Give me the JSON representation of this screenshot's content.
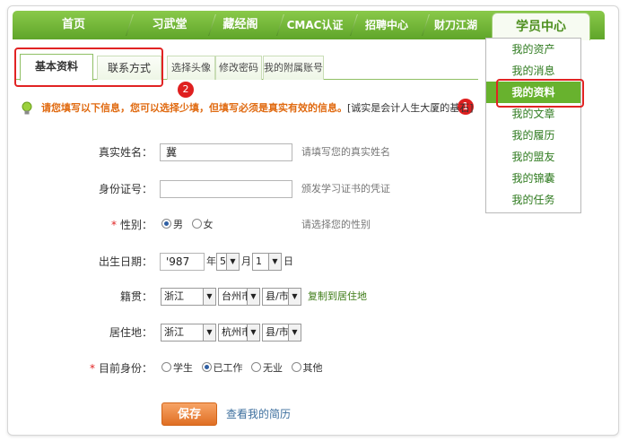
{
  "nav": {
    "items": [
      "首页",
      "习武堂",
      "藏经阁",
      "CMAC认证",
      "招聘中心",
      "财刀江湖"
    ],
    "active": "学员中心"
  },
  "dropdown": {
    "items": [
      "我的资产",
      "我的消息",
      "我的资料",
      "我的文章",
      "我的履历",
      "我的盟友",
      "我的锦囊",
      "我的任务"
    ],
    "active_index": 2
  },
  "annotations": {
    "badge1": "1",
    "badge2": "2"
  },
  "tabs": [
    "基本资料",
    "联系方式",
    "选择头像",
    "修改密码",
    "我的附属账号"
  ],
  "notice": {
    "main": "请您填写以下信息，您可以选择少填，但填写必须是真实有效的信息。",
    "sub": "诚实是会计人生大厦的基石"
  },
  "form": {
    "realname": {
      "label": "真实姓名：",
      "value": "冀",
      "hint": "请填写您的真实姓名"
    },
    "idcard": {
      "label": "身份证号：",
      "value": "",
      "hint": "颁发学习证书的凭证"
    },
    "gender": {
      "label": "性别：",
      "options": [
        "男",
        "女"
      ],
      "selected": "男",
      "hint": "请选择您的性别"
    },
    "birth": {
      "label": "出生日期：",
      "year": "'987",
      "year_unit": "年",
      "month": "5",
      "month_unit": "月",
      "day": "1",
      "day_unit": "日"
    },
    "native": {
      "label": "籍贯：",
      "province": "浙江",
      "city": "台州市",
      "county": "县/市",
      "copy_link": "复制到居住地"
    },
    "residence": {
      "label": "居住地：",
      "province": "浙江",
      "city": "杭州市",
      "county": "县/市"
    },
    "identity": {
      "label": "目前身份：",
      "options": [
        "学生",
        "已工作",
        "无业",
        "其他"
      ],
      "selected": "已工作"
    }
  },
  "actions": {
    "save": "保存",
    "view_resume": "查看我的简历"
  },
  "colors": {
    "nav_green": "#6cb536",
    "accent_orange": "#e06a10",
    "highlight_red": "#e12323"
  }
}
